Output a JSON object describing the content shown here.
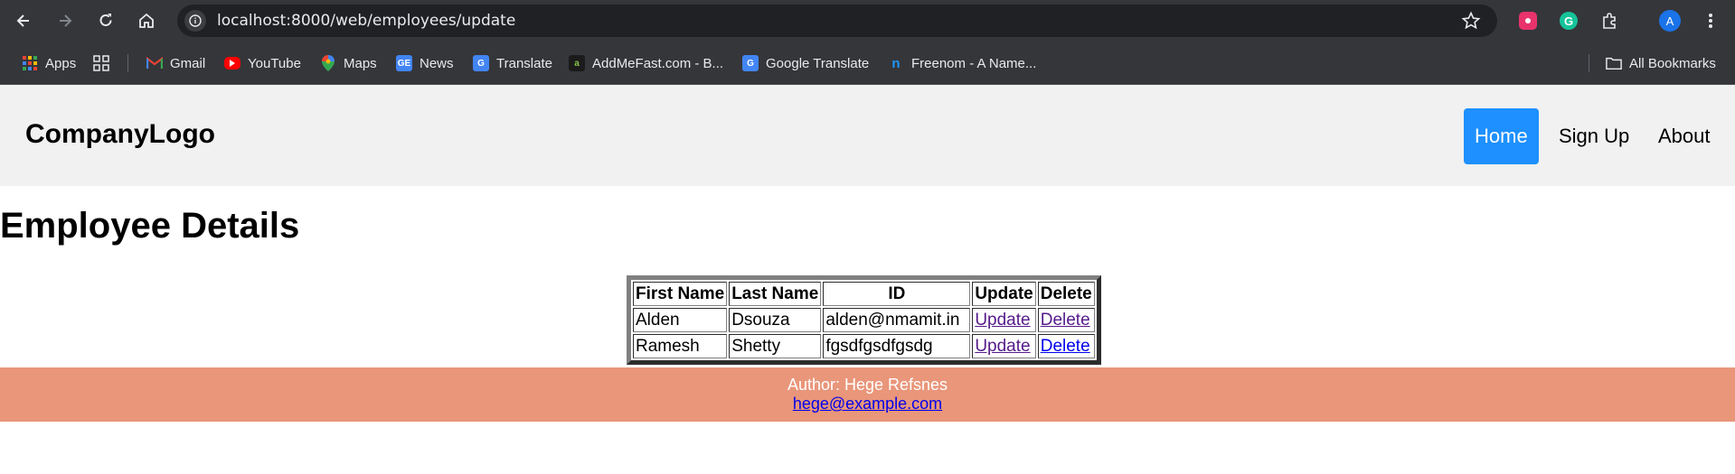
{
  "browser": {
    "url": "localhost:8000/web/employees/update",
    "profile_initial": "A",
    "bookmarks": [
      {
        "label": "Apps",
        "icon": "apps-grid-icon"
      },
      {
        "label": "Gmail",
        "icon": "gmail-icon"
      },
      {
        "label": "YouTube",
        "icon": "youtube-icon"
      },
      {
        "label": "Maps",
        "icon": "maps-icon"
      },
      {
        "label": "News",
        "icon": "news-icon"
      },
      {
        "label": "Translate",
        "icon": "translate-icon"
      },
      {
        "label": "AddMeFast.com - B...",
        "icon": "addmefast-icon"
      },
      {
        "label": "Google Translate",
        "icon": "google-translate-icon"
      },
      {
        "label": "Freenom - A Name...",
        "icon": "freenom-icon"
      }
    ],
    "all_bookmarks_label": "All Bookmarks"
  },
  "header": {
    "logo": "CompanyLogo",
    "nav": [
      {
        "label": "Home",
        "active": true
      },
      {
        "label": "Sign Up",
        "active": false
      },
      {
        "label": "About",
        "active": false
      }
    ]
  },
  "main": {
    "title": "Employee Details",
    "table": {
      "columns": [
        "First Name",
        "Last Name",
        "ID",
        "Update",
        "Delete"
      ],
      "rows": [
        {
          "first_name": "Alden",
          "last_name": "Dsouza",
          "id": "alden@nmamit.in",
          "update": "Update",
          "delete": "Delete"
        },
        {
          "first_name": "Ramesh",
          "last_name": "Shetty",
          "id": "fgsdfgsdfgsdg",
          "update": "Update",
          "delete": "Delete"
        }
      ]
    }
  },
  "footer": {
    "author": "Author: Hege Refsnes",
    "email": "hege@example.com"
  },
  "colors": {
    "nav_active": "#1e90ff",
    "header_bg": "#f1f1f1",
    "footer_bg": "#e9967a",
    "browser_bg": "#35363a"
  }
}
